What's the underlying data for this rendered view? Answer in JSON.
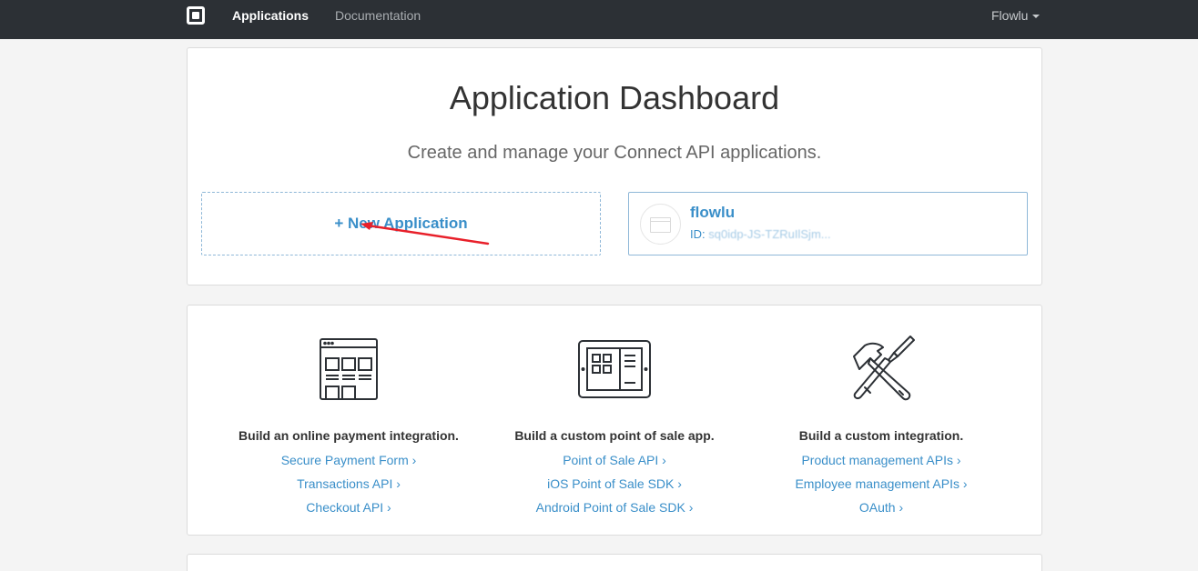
{
  "topbar": {
    "logo_icon": "square-logo-icon",
    "nav": [
      {
        "label": "Applications",
        "active": true
      },
      {
        "label": "Documentation",
        "active": false
      }
    ],
    "user": "Flowlu"
  },
  "dashboard": {
    "title": "Application Dashboard",
    "subtitle": "Create and manage your Connect API applications.",
    "new_app_label": "+ New Application",
    "app": {
      "name": "flowlu",
      "id_label": "ID:",
      "id_value": "sq0idp-JS-TZRuIlSjm..."
    }
  },
  "integrations": [
    {
      "icon": "browser-grid-icon",
      "heading": "Build an online payment integration.",
      "links": [
        "Secure Payment Form ›",
        "Transactions API ›",
        "Checkout API ›"
      ]
    },
    {
      "icon": "tablet-pos-icon",
      "heading": "Build a custom point of sale app.",
      "links": [
        "Point of Sale API ›",
        "iOS Point of Sale SDK ›",
        "Android Point of Sale SDK ›"
      ]
    },
    {
      "icon": "hammer-screwdriver-icon",
      "heading": "Build a custom integration.",
      "links": [
        "Product management APIs ›",
        "Employee management APIs ›",
        "OAuth ›"
      ]
    }
  ],
  "colors": {
    "topbar": "#2c3035",
    "link": "#3a8fc9",
    "annotation_arrow": "#e8202a"
  }
}
